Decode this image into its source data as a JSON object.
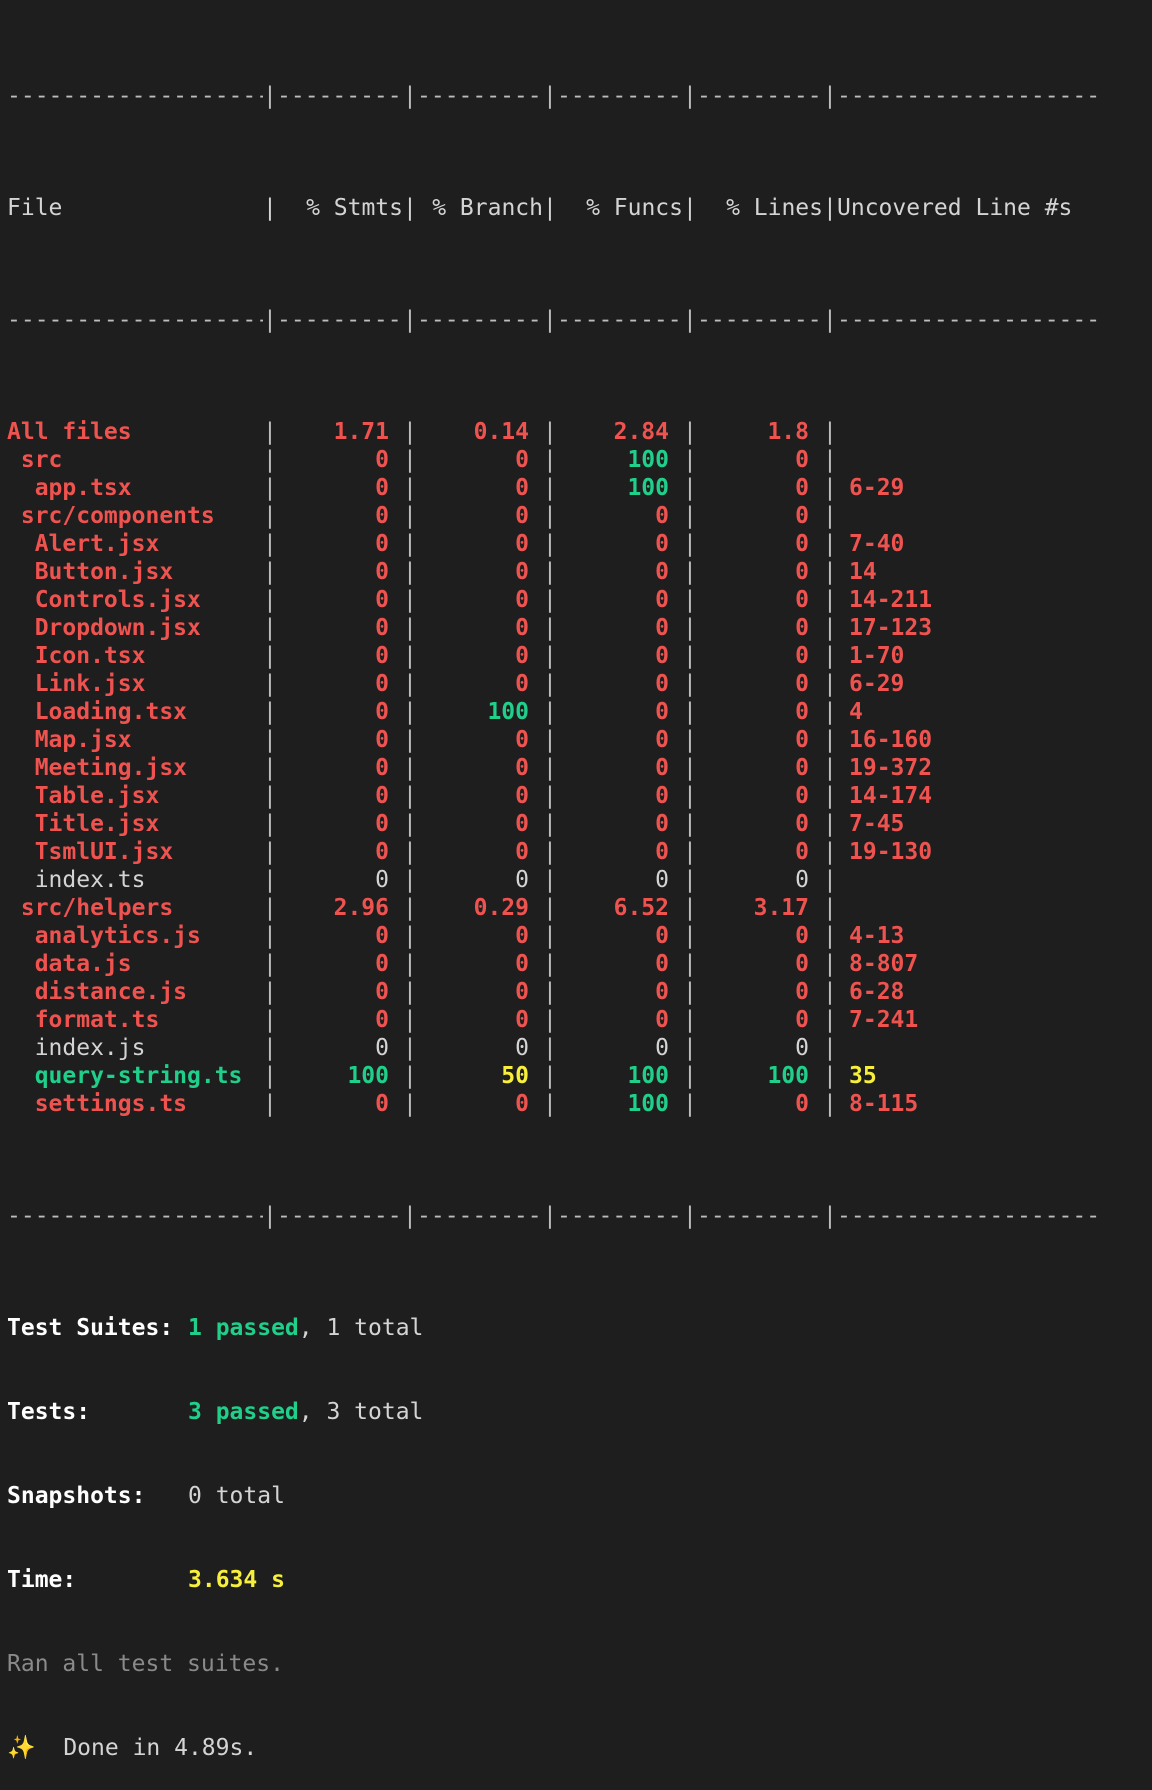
{
  "colors": {
    "background": "#1e1e1e",
    "red": "#ee5350",
    "green": "#1fcf8a",
    "yellow": "#f8ef3c",
    "dim": "#8a8a8a"
  },
  "header": {
    "file": "File",
    "stmts": "% Stmts",
    "branch": "% Branch",
    "funcs": "% Funcs",
    "lines": "% Lines",
    "uncovered": "Uncovered Line #s"
  },
  "separator": {
    "file": "-------------------",
    "stmts": "----------",
    "branch": "----------",
    "funcs": "----------",
    "lines": "----------",
    "uncovered": "-------------------"
  },
  "rows": [
    {
      "file": "All files",
      "fc": "red",
      "stmts": "1.71",
      "sc": "red",
      "branch": "0.14",
      "bc": "red",
      "funcs": "2.84",
      "fnc": "red",
      "lines": "1.8",
      "lc": "red",
      "unc": "",
      "uc": "red"
    },
    {
      "file": " src",
      "fc": "red",
      "stmts": "0",
      "sc": "red",
      "branch": "0",
      "bc": "red",
      "funcs": "100",
      "fnc": "green",
      "lines": "0",
      "lc": "red",
      "unc": "",
      "uc": "red"
    },
    {
      "file": "  app.tsx",
      "fc": "red",
      "stmts": "0",
      "sc": "red",
      "branch": "0",
      "bc": "red",
      "funcs": "100",
      "fnc": "green",
      "lines": "0",
      "lc": "red",
      "unc": "6-29",
      "uc": "red"
    },
    {
      "file": " src/components",
      "fc": "red",
      "stmts": "0",
      "sc": "red",
      "branch": "0",
      "bc": "red",
      "funcs": "0",
      "fnc": "red",
      "lines": "0",
      "lc": "red",
      "unc": "",
      "uc": "red"
    },
    {
      "file": "  Alert.jsx",
      "fc": "red",
      "stmts": "0",
      "sc": "red",
      "branch": "0",
      "bc": "red",
      "funcs": "0",
      "fnc": "red",
      "lines": "0",
      "lc": "red",
      "unc": "7-40",
      "uc": "red"
    },
    {
      "file": "  Button.jsx",
      "fc": "red",
      "stmts": "0",
      "sc": "red",
      "branch": "0",
      "bc": "red",
      "funcs": "0",
      "fnc": "red",
      "lines": "0",
      "lc": "red",
      "unc": "14",
      "uc": "red"
    },
    {
      "file": "  Controls.jsx",
      "fc": "red",
      "stmts": "0",
      "sc": "red",
      "branch": "0",
      "bc": "red",
      "funcs": "0",
      "fnc": "red",
      "lines": "0",
      "lc": "red",
      "unc": "14-211",
      "uc": "red"
    },
    {
      "file": "  Dropdown.jsx",
      "fc": "red",
      "stmts": "0",
      "sc": "red",
      "branch": "0",
      "bc": "red",
      "funcs": "0",
      "fnc": "red",
      "lines": "0",
      "lc": "red",
      "unc": "17-123",
      "uc": "red"
    },
    {
      "file": "  Icon.tsx",
      "fc": "red",
      "stmts": "0",
      "sc": "red",
      "branch": "0",
      "bc": "red",
      "funcs": "0",
      "fnc": "red",
      "lines": "0",
      "lc": "red",
      "unc": "1-70",
      "uc": "red"
    },
    {
      "file": "  Link.jsx",
      "fc": "red",
      "stmts": "0",
      "sc": "red",
      "branch": "0",
      "bc": "red",
      "funcs": "0",
      "fnc": "red",
      "lines": "0",
      "lc": "red",
      "unc": "6-29",
      "uc": "red"
    },
    {
      "file": "  Loading.tsx",
      "fc": "red",
      "stmts": "0",
      "sc": "red",
      "branch": "100",
      "bc": "green",
      "funcs": "0",
      "fnc": "red",
      "lines": "0",
      "lc": "red",
      "unc": "4",
      "uc": "red"
    },
    {
      "file": "  Map.jsx",
      "fc": "red",
      "stmts": "0",
      "sc": "red",
      "branch": "0",
      "bc": "red",
      "funcs": "0",
      "fnc": "red",
      "lines": "0",
      "lc": "red",
      "unc": "16-160",
      "uc": "red"
    },
    {
      "file": "  Meeting.jsx",
      "fc": "red",
      "stmts": "0",
      "sc": "red",
      "branch": "0",
      "bc": "red",
      "funcs": "0",
      "fnc": "red",
      "lines": "0",
      "lc": "red",
      "unc": "19-372",
      "uc": "red"
    },
    {
      "file": "  Table.jsx",
      "fc": "red",
      "stmts": "0",
      "sc": "red",
      "branch": "0",
      "bc": "red",
      "funcs": "0",
      "fnc": "red",
      "lines": "0",
      "lc": "red",
      "unc": "14-174",
      "uc": "red"
    },
    {
      "file": "  Title.jsx",
      "fc": "red",
      "stmts": "0",
      "sc": "red",
      "branch": "0",
      "bc": "red",
      "funcs": "0",
      "fnc": "red",
      "lines": "0",
      "lc": "red",
      "unc": "7-45",
      "uc": "red"
    },
    {
      "file": "  TsmlUI.jsx",
      "fc": "red",
      "stmts": "0",
      "sc": "red",
      "branch": "0",
      "bc": "red",
      "funcs": "0",
      "fnc": "red",
      "lines": "0",
      "lc": "red",
      "unc": "19-130",
      "uc": "red"
    },
    {
      "file": "  index.ts",
      "fc": "plain",
      "stmts": "0",
      "sc": "plain",
      "branch": "0",
      "bc": "plain",
      "funcs": "0",
      "fnc": "plain",
      "lines": "0",
      "lc": "plain",
      "unc": "",
      "uc": "plain"
    },
    {
      "file": " src/helpers",
      "fc": "red",
      "stmts": "2.96",
      "sc": "red",
      "branch": "0.29",
      "bc": "red",
      "funcs": "6.52",
      "fnc": "red",
      "lines": "3.17",
      "lc": "red",
      "unc": "",
      "uc": "red"
    },
    {
      "file": "  analytics.js",
      "fc": "red",
      "stmts": "0",
      "sc": "red",
      "branch": "0",
      "bc": "red",
      "funcs": "0",
      "fnc": "red",
      "lines": "0",
      "lc": "red",
      "unc": "4-13",
      "uc": "red"
    },
    {
      "file": "  data.js",
      "fc": "red",
      "stmts": "0",
      "sc": "red",
      "branch": "0",
      "bc": "red",
      "funcs": "0",
      "fnc": "red",
      "lines": "0",
      "lc": "red",
      "unc": "8-807",
      "uc": "red"
    },
    {
      "file": "  distance.js",
      "fc": "red",
      "stmts": "0",
      "sc": "red",
      "branch": "0",
      "bc": "red",
      "funcs": "0",
      "fnc": "red",
      "lines": "0",
      "lc": "red",
      "unc": "6-28",
      "uc": "red"
    },
    {
      "file": "  format.ts",
      "fc": "red",
      "stmts": "0",
      "sc": "red",
      "branch": "0",
      "bc": "red",
      "funcs": "0",
      "fnc": "red",
      "lines": "0",
      "lc": "red",
      "unc": "7-241",
      "uc": "red"
    },
    {
      "file": "  index.js",
      "fc": "plain",
      "stmts": "0",
      "sc": "plain",
      "branch": "0",
      "bc": "plain",
      "funcs": "0",
      "fnc": "plain",
      "lines": "0",
      "lc": "plain",
      "unc": "",
      "uc": "plain"
    },
    {
      "file": "  query-string.ts",
      "fc": "green",
      "stmts": "100",
      "sc": "green",
      "branch": "50",
      "bc": "yellow",
      "funcs": "100",
      "fnc": "green",
      "lines": "100",
      "lc": "green",
      "unc": "35",
      "uc": "yellow"
    },
    {
      "file": "  settings.ts",
      "fc": "red",
      "stmts": "0",
      "sc": "red",
      "branch": "0",
      "bc": "red",
      "funcs": "100",
      "fnc": "green",
      "lines": "0",
      "lc": "red",
      "unc": "8-115",
      "uc": "red"
    }
  ],
  "summary": {
    "suites_label": "Test Suites:",
    "suites_passed": "1 passed",
    "suites_total": ", 1 total",
    "tests_label": "Tests:",
    "tests_passed": "3 passed",
    "tests_total": ", 3 total",
    "snapshots_label": "Snapshots:",
    "snapshots_value": "0 total",
    "time_label": "Time:",
    "time_value": "3.634 s",
    "ran_all": "Ran all test suites.",
    "done_icon": "✨",
    "done_text": "  Done in 4.89s."
  }
}
